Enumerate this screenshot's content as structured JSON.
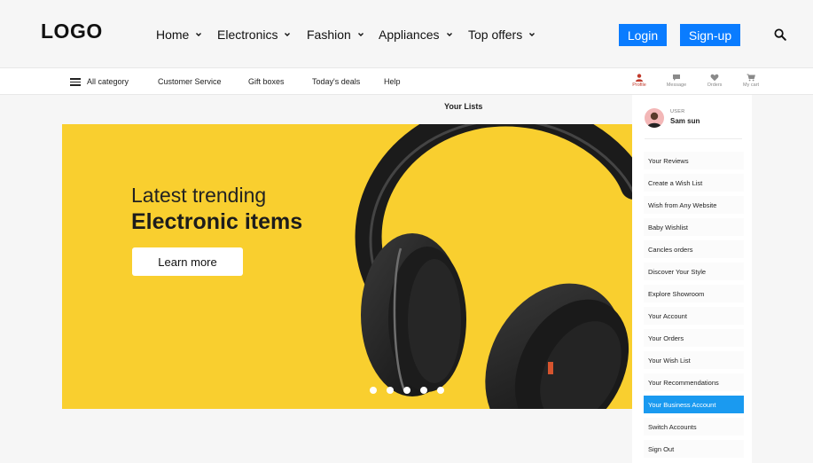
{
  "header": {
    "logo": "LOGO",
    "nav": [
      {
        "label": "Home"
      },
      {
        "label": "Electronics"
      },
      {
        "label": "Fashion"
      },
      {
        "label": "Appliances"
      },
      {
        "label": "Top offers"
      }
    ],
    "login_label": "Login",
    "signup_label": "Sign-up",
    "accent": "#0a7cff"
  },
  "subnav": {
    "items": [
      "All category",
      "Customer Service",
      "Gift boxes",
      "Today's deals",
      "Help"
    ],
    "quick": [
      {
        "label": "Profile",
        "icon": "profile-icon",
        "active": true
      },
      {
        "label": "Message",
        "icon": "message-icon",
        "active": false
      },
      {
        "label": "Orders",
        "icon": "heart-icon",
        "active": false
      },
      {
        "label": "My cart",
        "icon": "cart-icon",
        "active": false
      }
    ]
  },
  "hero": {
    "line1": "Latest trending",
    "line2": "Electronic items",
    "cta": "Learn more",
    "bg_color": "#f9cf2f",
    "slide_count": 5
  },
  "lists": {
    "title": "Your Lists",
    "user_tag": "USER",
    "user_name": "Sam sun",
    "items": [
      "Your  Reviews",
      "Create a Wish List",
      "Wish from Any Website",
      "Baby Wishlist",
      "Cancles orders",
      "Discover Your Style",
      "Explore Showroom",
      "Your Account",
      "Your Orders",
      "Your Wish List",
      "Your Recommendations",
      "Your Business Account",
      "Switch Accounts",
      "Sign Out"
    ],
    "active_item": "Your Business Account",
    "active_color": "#1a9af0"
  }
}
